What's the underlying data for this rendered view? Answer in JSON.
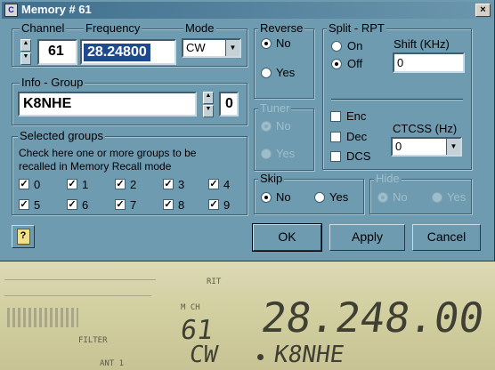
{
  "window": {
    "title": "Memory # 61",
    "close_label": "×",
    "app_icon": "app-icon"
  },
  "channel": {
    "label": "Channel",
    "value": "61"
  },
  "frequency": {
    "label": "Frequency",
    "value": "28.24800"
  },
  "mode": {
    "label": "Mode",
    "value": "CW",
    "dropdown_icon": "chevron-down-icon"
  },
  "info_group": {
    "label": "Info - Group",
    "value": "K8NHE",
    "group_value": "0"
  },
  "reverse": {
    "label": "Reverse",
    "options": [
      "No",
      "Yes"
    ],
    "selected": "No"
  },
  "tuner": {
    "label": "Tuner",
    "options": [
      "No",
      "Yes"
    ],
    "selected": "No",
    "enabled": false
  },
  "split_rpt": {
    "label": "Split - RPT",
    "options": [
      "On",
      "Off"
    ],
    "selected": "Off",
    "shift_label": "Shift (KHz)",
    "shift_value": "0",
    "enc_label": "Enc",
    "dec_label": "Dec",
    "dcs_label": "DCS",
    "ctcss_label": "CTCSS (Hz)",
    "ctcss_value": "0"
  },
  "selected_groups": {
    "label": "Selected groups",
    "description_line1": "Check here one or more groups to be",
    "description_line2": "recalled in Memory Recall mode",
    "groups": [
      {
        "label": "0",
        "checked": true
      },
      {
        "label": "1",
        "checked": true
      },
      {
        "label": "2",
        "checked": true
      },
      {
        "label": "3",
        "checked": true
      },
      {
        "label": "4",
        "checked": true
      },
      {
        "label": "5",
        "checked": true
      },
      {
        "label": "6",
        "checked": true
      },
      {
        "label": "7",
        "checked": true
      },
      {
        "label": "8",
        "checked": true
      },
      {
        "label": "9",
        "checked": true
      }
    ]
  },
  "skip": {
    "label": "Skip",
    "options": [
      "No",
      "Yes"
    ],
    "selected": "No"
  },
  "hide": {
    "label": "Hide",
    "options": [
      "No",
      "Yes"
    ],
    "selected": "No",
    "enabled": false
  },
  "buttons": {
    "help_icon": "help-icon",
    "ok": "OK",
    "apply": "Apply",
    "cancel": "Cancel"
  },
  "radio_display": {
    "channel": "61",
    "frequency": "28.248.00",
    "mode": "CW",
    "memo_name": "K8NHE",
    "mch_label": "M CH",
    "ant_label": "ANT 1",
    "filter_label": "FILTER",
    "rit_label": "RIT"
  }
}
